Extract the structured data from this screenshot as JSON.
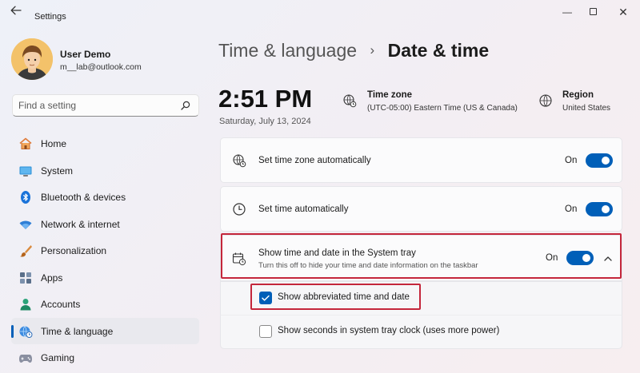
{
  "window": {
    "title": "Settings",
    "back_icon": "arrow-left-icon",
    "controls": {
      "minimize": "—",
      "close": "✕"
    }
  },
  "user": {
    "name": "User Demo",
    "email": "m__lab@outlook.com"
  },
  "search": {
    "placeholder": "Find a setting",
    "icon": "search-icon"
  },
  "nav": {
    "items": [
      {
        "label": "Home",
        "icon": "home-icon"
      },
      {
        "label": "System",
        "icon": "monitor-icon"
      },
      {
        "label": "Bluetooth & devices",
        "icon": "bluetooth-icon"
      },
      {
        "label": "Network & internet",
        "icon": "wifi-icon"
      },
      {
        "label": "Personalization",
        "icon": "brush-icon"
      },
      {
        "label": "Apps",
        "icon": "apps-icon"
      },
      {
        "label": "Accounts",
        "icon": "person-icon"
      },
      {
        "label": "Time & language",
        "icon": "globe-clock-icon",
        "active": true
      },
      {
        "label": "Gaming",
        "icon": "gamepad-icon"
      }
    ]
  },
  "breadcrumb": {
    "parent": "Time & language",
    "separator": "›",
    "current": "Date & time"
  },
  "clock": {
    "time": "2:51 PM",
    "date": "Saturday, July 13, 2024"
  },
  "time_zone": {
    "title": "Time zone",
    "value": "(UTC-05:00) Eastern Time (US & Canada)"
  },
  "region": {
    "title": "Region",
    "value": "United States"
  },
  "settings": {
    "auto_timezone": {
      "label": "Set time zone automatically",
      "state": "On"
    },
    "auto_time": {
      "label": "Set time automatically",
      "state": "On"
    },
    "system_tray": {
      "label": "Show time and date in the System tray",
      "description": "Turn this off to hide your time and date information on the taskbar",
      "state": "On"
    },
    "abbreviated": {
      "label": "Show abbreviated time and date",
      "checked": true
    },
    "seconds": {
      "label": "Show seconds in system tray clock (uses more power)",
      "checked": false
    }
  },
  "colors": {
    "accent": "#005fb8",
    "highlight": "#c4263b"
  }
}
